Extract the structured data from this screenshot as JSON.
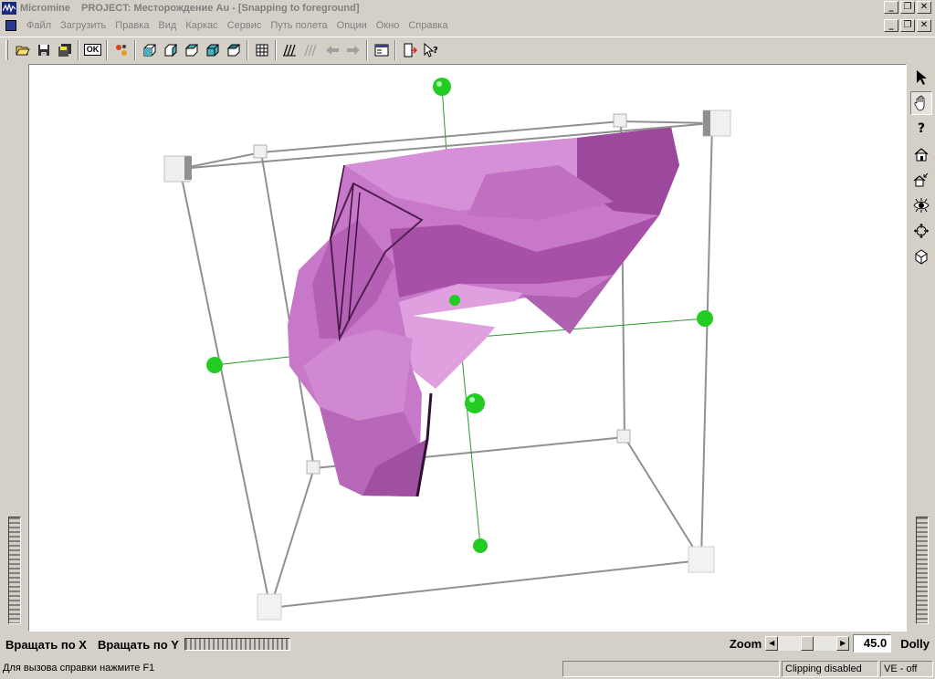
{
  "titlebar": {
    "app_name": "Micromine",
    "project": "PROJECT: Месторождение Au - [Snapping to foreground]",
    "buttons": [
      "_",
      "❐",
      "✕"
    ]
  },
  "menubar": {
    "items": [
      "Файл",
      "Загрузить",
      "Правка",
      "Вид",
      "Каркас",
      "Сервис",
      "Путь полета",
      "Опции",
      "Окно",
      "Справка"
    ],
    "buttons": [
      "_",
      "❐",
      "✕"
    ]
  },
  "toolbar": {
    "ok_label": "OK"
  },
  "right_tools": {
    "help_label": "?"
  },
  "bottom": {
    "rotate_x_label": "Вращать по  X",
    "rotate_y_label": "Вращать по Y",
    "zoom_label": "Zoom",
    "zoom_value": "45.0",
    "zoom_fraction": 0.5,
    "dolly_label": "Dolly"
  },
  "status": {
    "help_text": "Для вызова справки нажмите F1",
    "clipping": "Clipping disabled",
    "ve": "VE - off"
  },
  "colors": {
    "solid_fill": "#c878c8",
    "axis_green": "#22cc22",
    "box_edge": "#888888"
  }
}
